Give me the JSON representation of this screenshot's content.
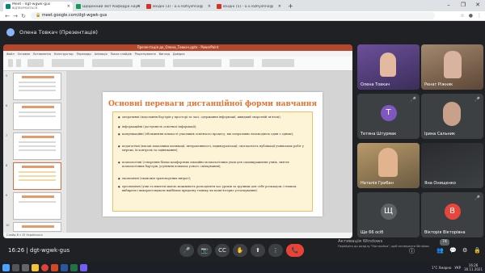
{
  "browser": {
    "tabs": [
      {
        "title": "Meet - dgt-wgwk-gus",
        "subtitle": "ВІДТВОРЮЄТЬСЯ",
        "color": "#00897b",
        "active": true
      },
      {
        "title": "Щоденний звіт Кафедра наук",
        "subtitle": "",
        "color": "#0f9d58",
        "active": false
      },
      {
        "title": "Вхідні (3) - o.v.rozhyshna@",
        "subtitle": "",
        "color": "#d93025",
        "active": false
      },
      {
        "title": "Вхідні (5) - o.v.rozhyshna@",
        "subtitle": "",
        "color": "#d93025",
        "active": false
      }
    ],
    "url": "meet.google.com/dgt-wgwk-gus",
    "newtab": "+",
    "win": [
      "–",
      "❐",
      "✕"
    ]
  },
  "meeting": {
    "presenter": "Олена Товкач (Презентація)",
    "time": "16:26",
    "code": "dgt-wgwk-gus",
    "people_count": "74"
  },
  "ppt": {
    "title_bar": "Презентація до_Олена_Товкач.pptx - PowerPoint",
    "tabs": [
      "Файл",
      "Основне",
      "Вставлення",
      "Конструктор",
      "Переходи",
      "Анімація",
      "Показ слайдів",
      "Рецензування",
      "Вигляд",
      "Довідка"
    ],
    "status": "Слайд 8 з 15   Українська",
    "thumb_numbers": [
      "5",
      "6",
      "7",
      "8",
      "9",
      "10"
    ],
    "slide": {
      "title": "Основні переваги дистанційної форми навчання",
      "bullets": [
        "оперативні (подолання бар'єрів у просторі та часі, одержання інформації, швидкий зворотній зв'язок);",
        "інформаційні (доступність освітньої інформації);",
        "комунікаційні (збільшення кількості учасників освітнього процесу, які оперативно взаємодіють один з одним);",
        "педагогічні (високі показники мотивації, інтерактивності, індивідуалізації; своєчасність публікації учнівських робіт у мережі, їх контроль та оцінювання);",
        "психологічні (створення більш комфортних емоційно-психологічних умов для самовираження учнів, зняття психологічних бар'єрів, усунення помилок усного спілкування);",
        "економічні (економія транспортних витрат);",
        "ергономічні (учні та вчителі мають можливість розподіляти час уроків за зручним для себе розкладом і темпом, вибирати і використовувати найбільш придатну техніку чи комп'ютерне устаткування)."
      ]
    }
  },
  "participants": [
    {
      "name": "Олена Товкач",
      "type": "photo",
      "bg": "#5b4a7e"
    },
    {
      "name": "Ренат Ріжняк",
      "type": "photo",
      "bg": "#8a6d5a"
    },
    {
      "name": "Тетяна Штурмак",
      "type": "avatar",
      "initial": "Т",
      "bg": "#7e57c2"
    },
    {
      "name": "Ірина Сальник",
      "type": "photo",
      "bg": "#4f4b45"
    },
    {
      "name": "Наталія Грибан",
      "type": "photo",
      "bg": "#8f7a5a"
    },
    {
      "name": "Яна Онищенко",
      "type": "photo",
      "bg": "#3c4043"
    },
    {
      "name": "Ще 66 осіб",
      "type": "avatar",
      "initial": "Щ",
      "bg": "#5f6368"
    },
    {
      "name": "Вікторія Вікторівна",
      "type": "avatar",
      "initial": "В",
      "bg": "#e8453c"
    }
  ],
  "activation": {
    "line1": "Активація Windows",
    "line2": "Перейдіть до розділу \"Настройки\", щоб активувати Windows."
  },
  "tray": {
    "weather": "1°C Хмарно",
    "lang": "УКР",
    "time": "16:26",
    "date": "30.11.2021"
  },
  "icons": {
    "mic": "🎤",
    "cam": "📷",
    "cc": "CC",
    "hand": "✋",
    "present": "⬆",
    "more": "⋮",
    "end": "📞",
    "info": "ⓘ",
    "people": "👥",
    "chat": "💬",
    "activities": "⚙",
    "lock": "🔒"
  }
}
